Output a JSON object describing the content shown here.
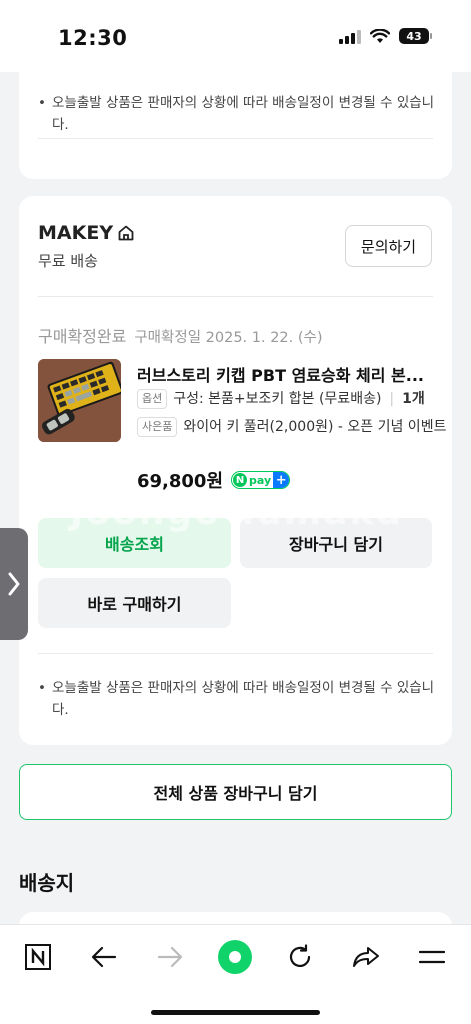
{
  "status_bar": {
    "time": "12:30",
    "battery": "43"
  },
  "notice_text": "오늘출발 상품은 판매자의 상황에 따라 배송일정이 변경될 수 있습니다.",
  "seller": {
    "name": "MAKEY",
    "shipping": "무료 배송",
    "inquiry_label": "문의하기"
  },
  "order": {
    "status": "구매확정완료",
    "date": "구매확정일 2025. 1. 22. (수)",
    "product_name": "러브스토리 키캡 PBT 염료승화 체리 본...",
    "option_tag": "옵션",
    "option_text": "구성: 본품+보조키 합본 (무료배송)",
    "quantity": "1개",
    "gift_tag": "사은품",
    "gift_text": "와이어 키 풀러(2,000원) - 오픈 기념 이벤트",
    "price": "69,800원",
    "npay_label": "pay"
  },
  "buttons": {
    "track": "배송조회",
    "cart": "장바구니 담기",
    "buy_now": "바로 구매하기",
    "cart_all": "전체 상품 장바구니 담기"
  },
  "watermark": "Joongo Tamaku",
  "section_title": "배송지",
  "colors": {
    "accent_green": "#03c75a",
    "npay_plus_blue": "#0a7bff"
  },
  "bottom_nav": [
    "naver-n-icon",
    "back-arrow-icon",
    "forward-arrow-icon",
    "green-dot-home-icon",
    "refresh-icon",
    "share-icon",
    "menu-icon"
  ]
}
